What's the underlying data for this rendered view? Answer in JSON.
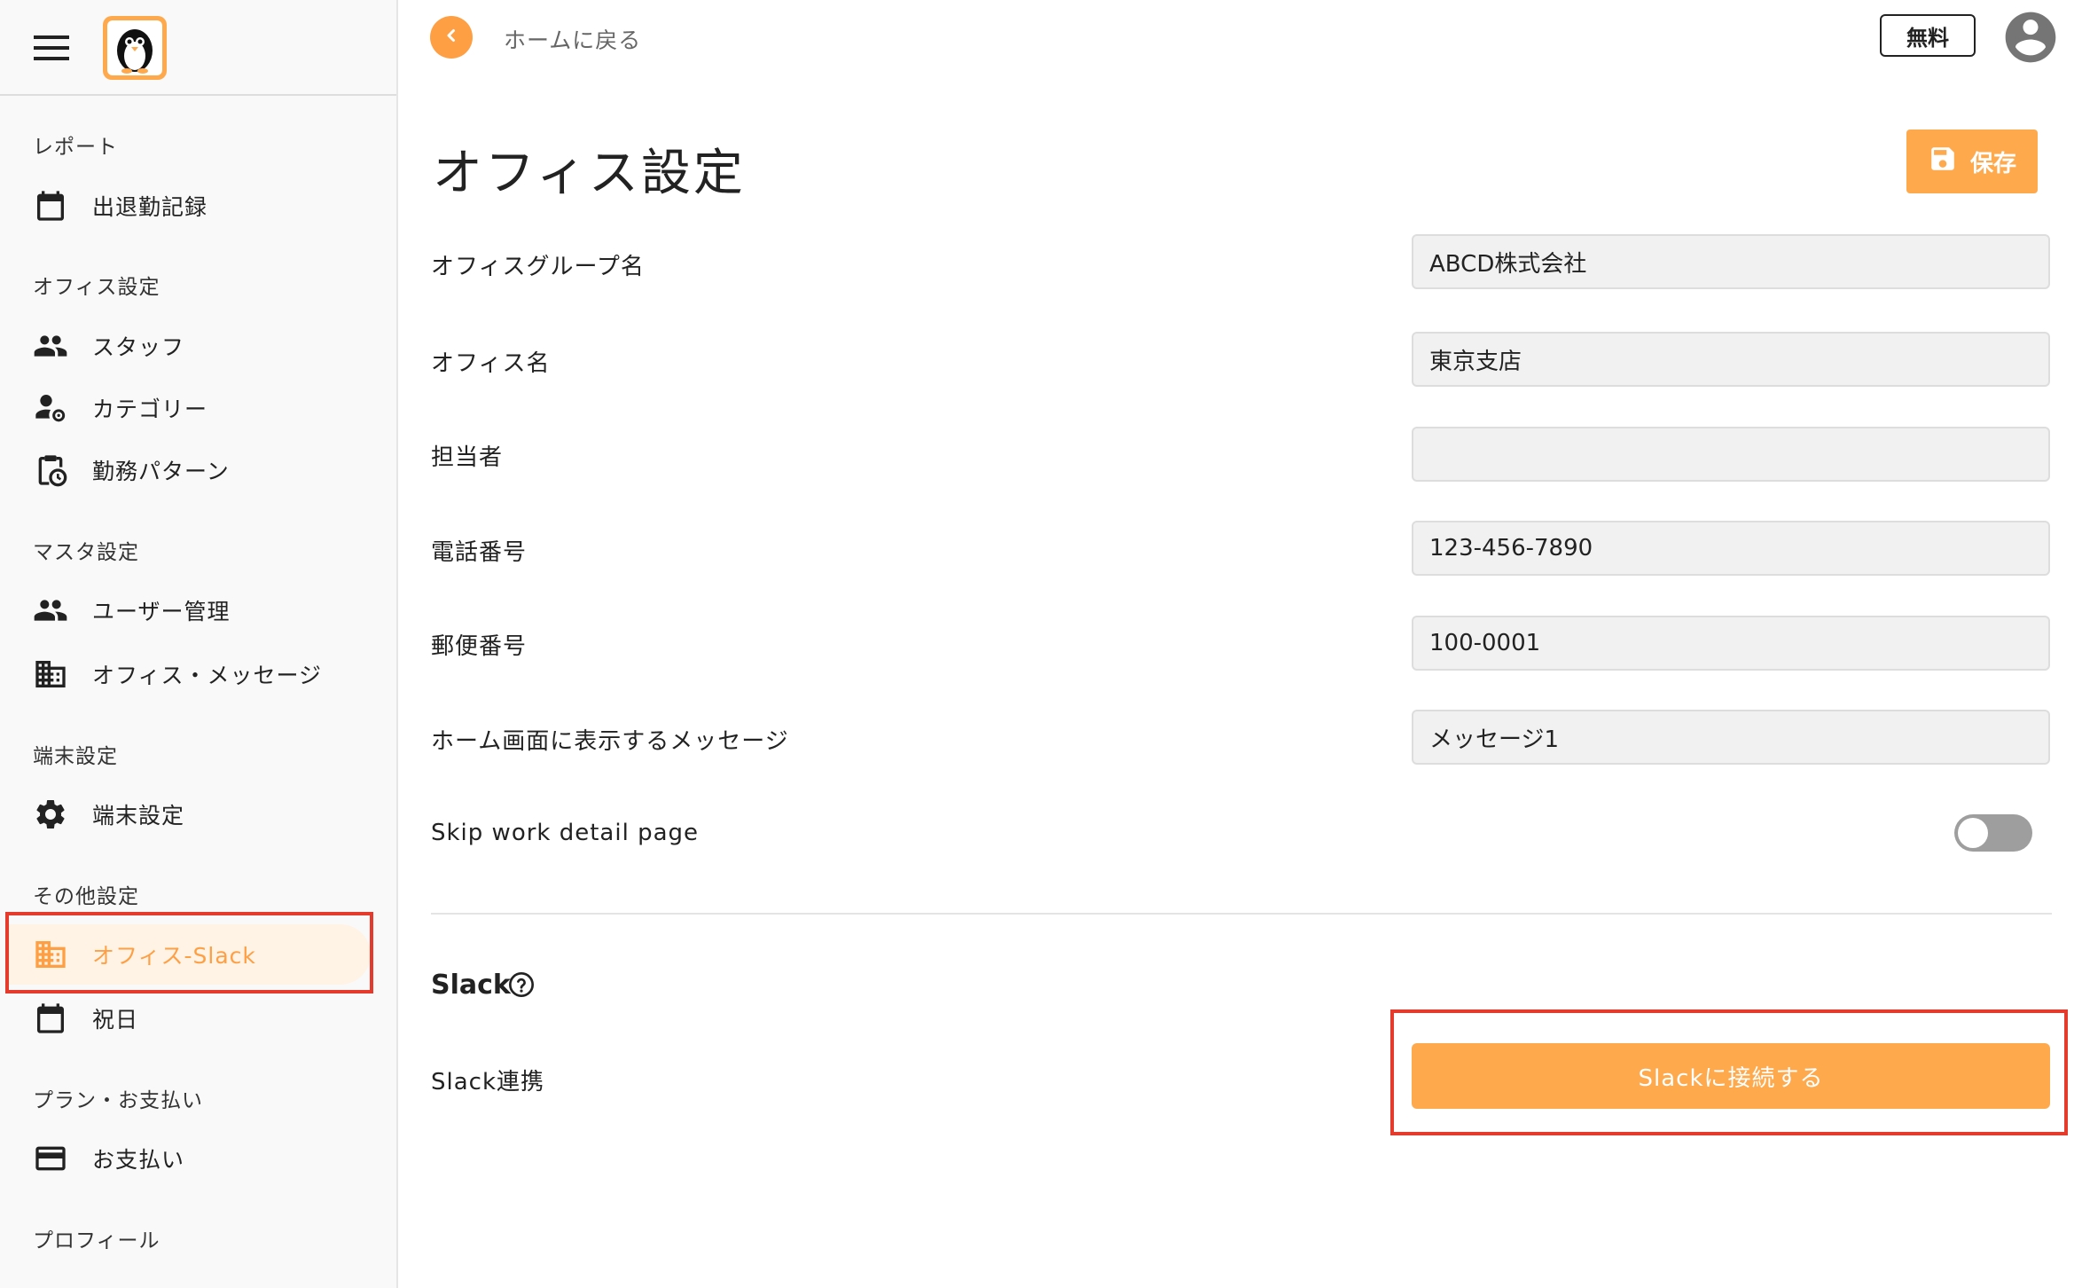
{
  "colors": {
    "accent": "#ffa94d",
    "accent_dark": "#ff9f43",
    "active_bg": "#fff3e6",
    "highlight_red": "#e53b2c",
    "input_bg": "#f1f1f1",
    "toggle_off": "#9e9e9e"
  },
  "sidebar": {
    "menu_icon": "hamburger-menu-icon",
    "logo_icon": "penguin-logo",
    "sections": [
      {
        "label": "レポート",
        "items": [
          {
            "label": "出退勤記録",
            "icon": "calendar-icon"
          }
        ]
      },
      {
        "label": "オフィス設定",
        "items": [
          {
            "label": "スタッフ",
            "icon": "people-icon"
          },
          {
            "label": "カテゴリー",
            "icon": "person-gear-icon"
          },
          {
            "label": "勤務パターン",
            "icon": "clipboard-clock-icon"
          }
        ]
      },
      {
        "label": "マスタ設定",
        "items": [
          {
            "label": "ユーザー管理",
            "icon": "people-icon"
          },
          {
            "label": "オフィス・メッセージ",
            "icon": "building-icon"
          }
        ]
      },
      {
        "label": "端末設定",
        "items": [
          {
            "label": "端末設定",
            "icon": "gear-icon"
          }
        ]
      },
      {
        "label": "その他設定",
        "items": [
          {
            "label": "オフィス-Slack",
            "icon": "building-icon",
            "active": true
          },
          {
            "label": "祝日",
            "icon": "calendar-icon"
          }
        ]
      },
      {
        "label": "プラン・お支払い",
        "items": [
          {
            "label": "お支払い",
            "icon": "credit-card-icon"
          }
        ]
      },
      {
        "label": "プロフィール",
        "items": []
      }
    ]
  },
  "header": {
    "back_label": "ホームに戻る",
    "back_icon": "chevron-left-icon",
    "plan_badge": "無料",
    "avatar_icon": "account-circle-icon"
  },
  "main": {
    "title": "オフィス設定",
    "save_label": "保存",
    "save_icon": "floppy-disk-icon",
    "fields": [
      {
        "label": "オフィスグループ名",
        "value": "ABCD株式会社"
      },
      {
        "label": "オフィス名",
        "value": "東京支店"
      },
      {
        "label": "担当者",
        "value": ""
      },
      {
        "label": "電話番号",
        "value": "123-456-7890"
      },
      {
        "label": "郵便番号",
        "value": "100-0001"
      },
      {
        "label": "ホーム画面に表示するメッセージ",
        "value": "メッセージ1"
      }
    ],
    "skip_toggle": {
      "label": "Skip work detail page",
      "checked": false
    },
    "slack": {
      "heading": "Slack",
      "help_icon": "help-circle-icon",
      "link_label": "Slack連携",
      "connect_button": "Slackに接続する"
    }
  }
}
